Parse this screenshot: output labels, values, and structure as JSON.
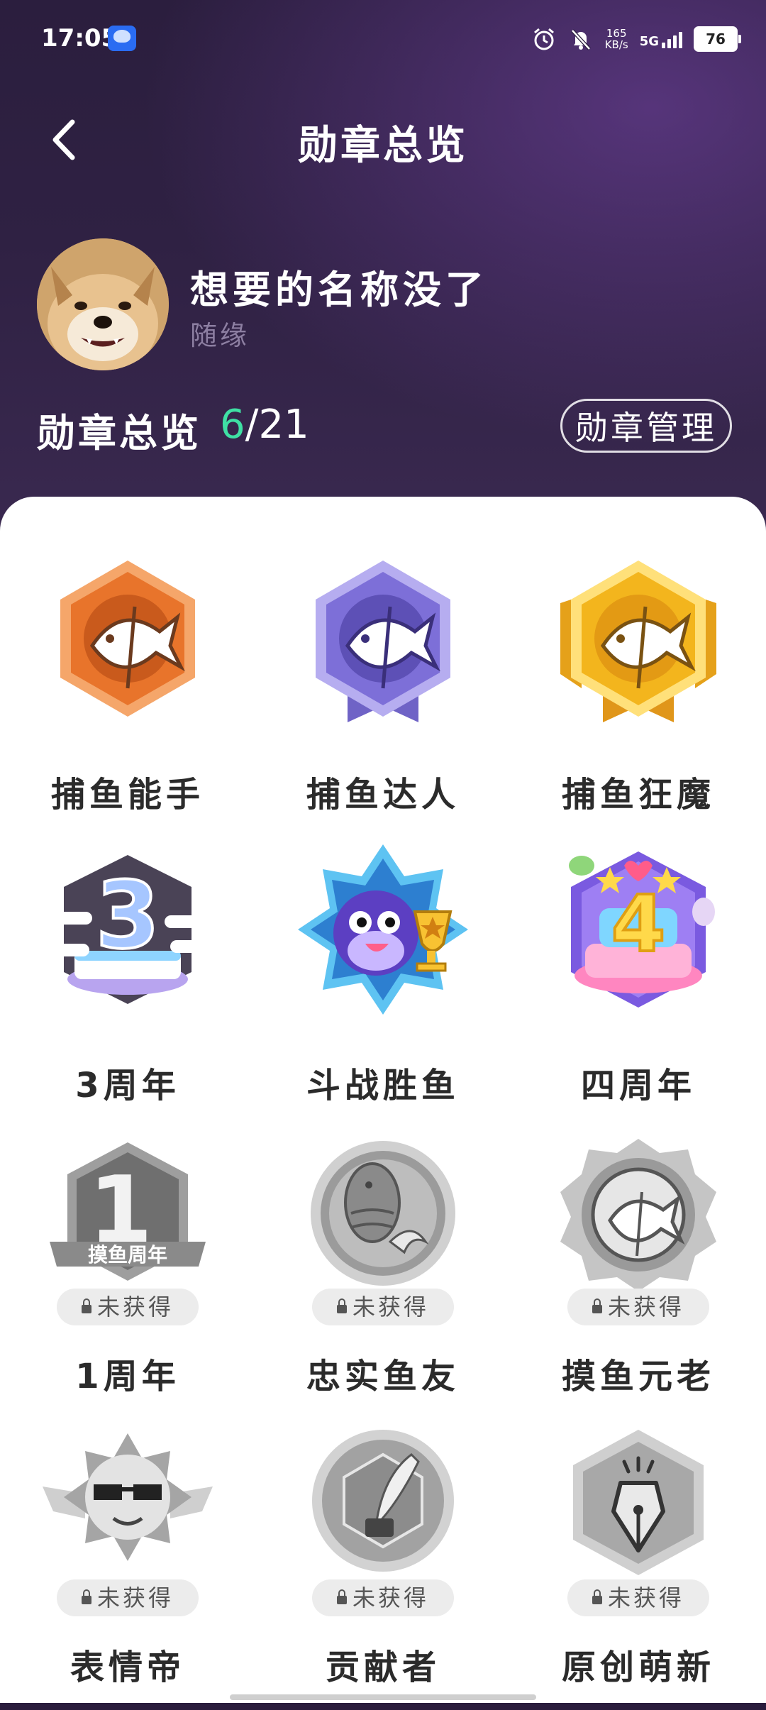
{
  "status_bar": {
    "time": "17:05",
    "net_speed_value": "165",
    "net_speed_unit": "KB/s",
    "network": "5G",
    "battery": "76"
  },
  "header": {
    "title": "勋章总览"
  },
  "profile": {
    "username": "想要的名称没了",
    "signature": "随缘"
  },
  "summary": {
    "label": "勋章总览",
    "earned": "6",
    "total": "/21",
    "manage_label": "勋章管理"
  },
  "locked_label": "未获得",
  "badges": [
    {
      "name": "捕鱼能手",
      "locked": false
    },
    {
      "name": "捕鱼达人",
      "locked": false
    },
    {
      "name": "捕鱼狂魔",
      "locked": false
    },
    {
      "name": "3周年",
      "locked": false
    },
    {
      "name": "斗战胜鱼",
      "locked": false
    },
    {
      "name": "四周年",
      "locked": false
    },
    {
      "name": "1周年",
      "locked": true
    },
    {
      "name": "忠实鱼友",
      "locked": true
    },
    {
      "name": "摸鱼元老",
      "locked": true
    },
    {
      "name": "表情帝",
      "locked": true
    },
    {
      "name": "贡献者",
      "locked": true
    },
    {
      "name": "原创萌新",
      "locked": true
    }
  ],
  "badge_art_text": {
    "years_3": "3",
    "years_4": "4",
    "years_1": "1",
    "one_year_banner": "摸鱼周年"
  },
  "colors": {
    "accent_green": "#3fe0a4",
    "orange": "#e8742b",
    "purple": "#7d6fd8",
    "gold": "#f3b51d",
    "locked_gray": "#bcbcbc"
  }
}
